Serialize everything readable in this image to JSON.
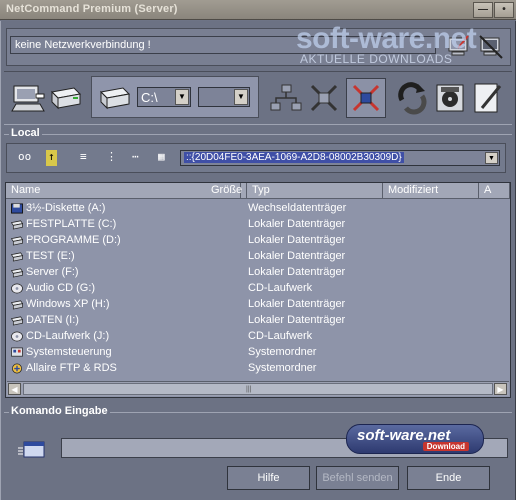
{
  "window": {
    "title": "NetCommand Premium (Server)",
    "minimize_glyph": "—",
    "close_glyph": "•"
  },
  "status": {
    "message": "keine Netzwerkverbindung !"
  },
  "watermark": {
    "title": "soft-ware.net",
    "subtitle": "AKTUELLE DOWNLOADS"
  },
  "toolbar": {
    "icons": [
      "computer-icon",
      "network-drive-icon",
      "drive-icon",
      "network-icon",
      "disconnect-icon",
      "disconnect-active-icon",
      "recycle-icon",
      "save-icon",
      "edit-icon"
    ],
    "drive_value": "C:\\",
    "second_value": ""
  },
  "local": {
    "label": "Local",
    "tools": [
      "oo",
      "↑",
      "≡",
      "⋮",
      "⋯",
      "▦"
    ],
    "path": "::{20D04FE0-3AEA-1069-A2D8-08002B30309D}"
  },
  "filelist": {
    "columns": [
      "Name",
      "Größe",
      "Typ",
      "Modifiziert",
      "A"
    ],
    "rows": [
      {
        "name": "3½-Diskette (A:)",
        "type": "Wechseldatenträger",
        "icon": "floppy-icon"
      },
      {
        "name": "FESTPLATTE (C:)",
        "type": "Lokaler Datenträger",
        "icon": "harddisk-icon"
      },
      {
        "name": "PROGRAMME (D:)",
        "type": "Lokaler Datenträger",
        "icon": "harddisk-icon"
      },
      {
        "name": "TEST (E:)",
        "type": "Lokaler Datenträger",
        "icon": "harddisk-icon"
      },
      {
        "name": "Server (F:)",
        "type": "Lokaler Datenträger",
        "icon": "harddisk-icon"
      },
      {
        "name": "Audio CD (G:)",
        "type": "CD-Laufwerk",
        "icon": "cd-icon"
      },
      {
        "name": "Windows XP (H:)",
        "type": "Lokaler Datenträger",
        "icon": "harddisk-icon"
      },
      {
        "name": "DATEN (I:)",
        "type": "Lokaler Datenträger",
        "icon": "harddisk-icon"
      },
      {
        "name": "CD-Laufwerk (J:)",
        "type": "CD-Laufwerk",
        "icon": "cd-icon"
      },
      {
        "name": "Systemsteuerung",
        "type": "Systemordner",
        "icon": "control-panel-icon"
      },
      {
        "name": "Allaire FTP & RDS",
        "type": "Systemordner",
        "icon": "ftp-icon"
      }
    ]
  },
  "command": {
    "label": "Komando Eingabe",
    "input_value": ""
  },
  "buttons": {
    "help": "Hilfe",
    "send": "Befehl senden",
    "end": "Ende"
  },
  "badge": {
    "title": "soft-ware.net",
    "sub": "Download"
  }
}
